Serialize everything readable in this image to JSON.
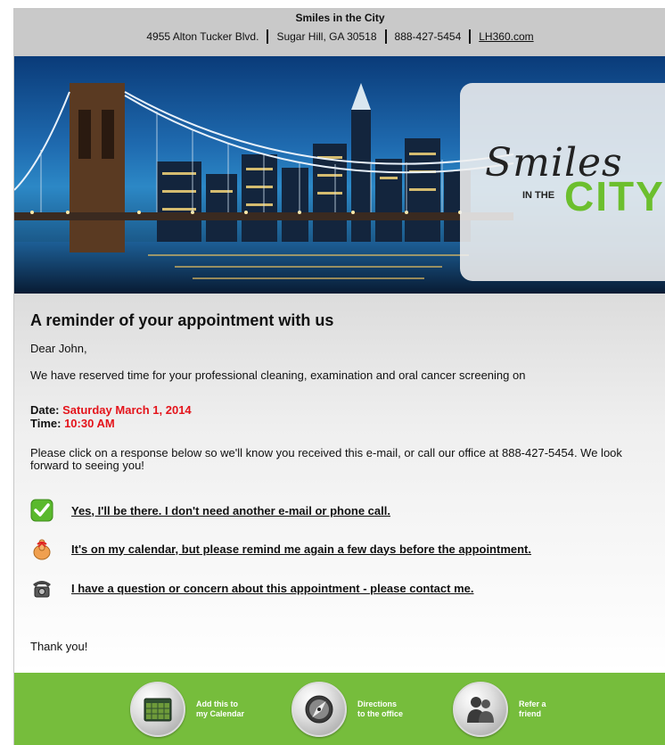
{
  "header": {
    "name": "Smiles in the City",
    "address": "4955 Alton Tucker Blvd.",
    "city": "Sugar Hill, GA 30518",
    "phone": "888-427-5454",
    "website": "LH360.com"
  },
  "logo": {
    "smiles": "Smiles",
    "in_the": "IN THE",
    "city": "CITY"
  },
  "body": {
    "heading": "A reminder of your appointment with us",
    "greeting": "Dear John,",
    "reserved": "We have reserved time for your professional cleaning, examination and oral cancer screening on",
    "date_label": "Date:",
    "date_value": "Saturday March 1, 2014",
    "time_label": "Time:",
    "time_value": "10:30 AM",
    "instructions": "Please click on a response below so we'll know you received this e-mail, or call our office at 888-427-5454. We look forward to seeing you!",
    "responses": [
      {
        "label": "Yes, I'll be there. I don't need another e-mail or phone call.",
        "icon": "checkmark-icon"
      },
      {
        "label": "It's on my calendar, but please remind me again a few days before the appointment.",
        "icon": "finger-string-icon"
      },
      {
        "label": "I have a question or concern about this appointment - please contact me.",
        "icon": "telephone-icon"
      }
    ],
    "thanks": "Thank you!"
  },
  "footer": {
    "buttons": [
      {
        "line1": "Add this to",
        "line2": "my Calendar",
        "icon": "calendar-icon"
      },
      {
        "line1": "Directions",
        "line2": "to the office",
        "icon": "compass-icon"
      },
      {
        "line1": "Refer a",
        "line2": "friend",
        "icon": "people-icon"
      }
    ]
  },
  "colors": {
    "accent_green": "#76bd3c",
    "highlight_red": "#e4141b",
    "header_gray": "#c9c9c9"
  }
}
